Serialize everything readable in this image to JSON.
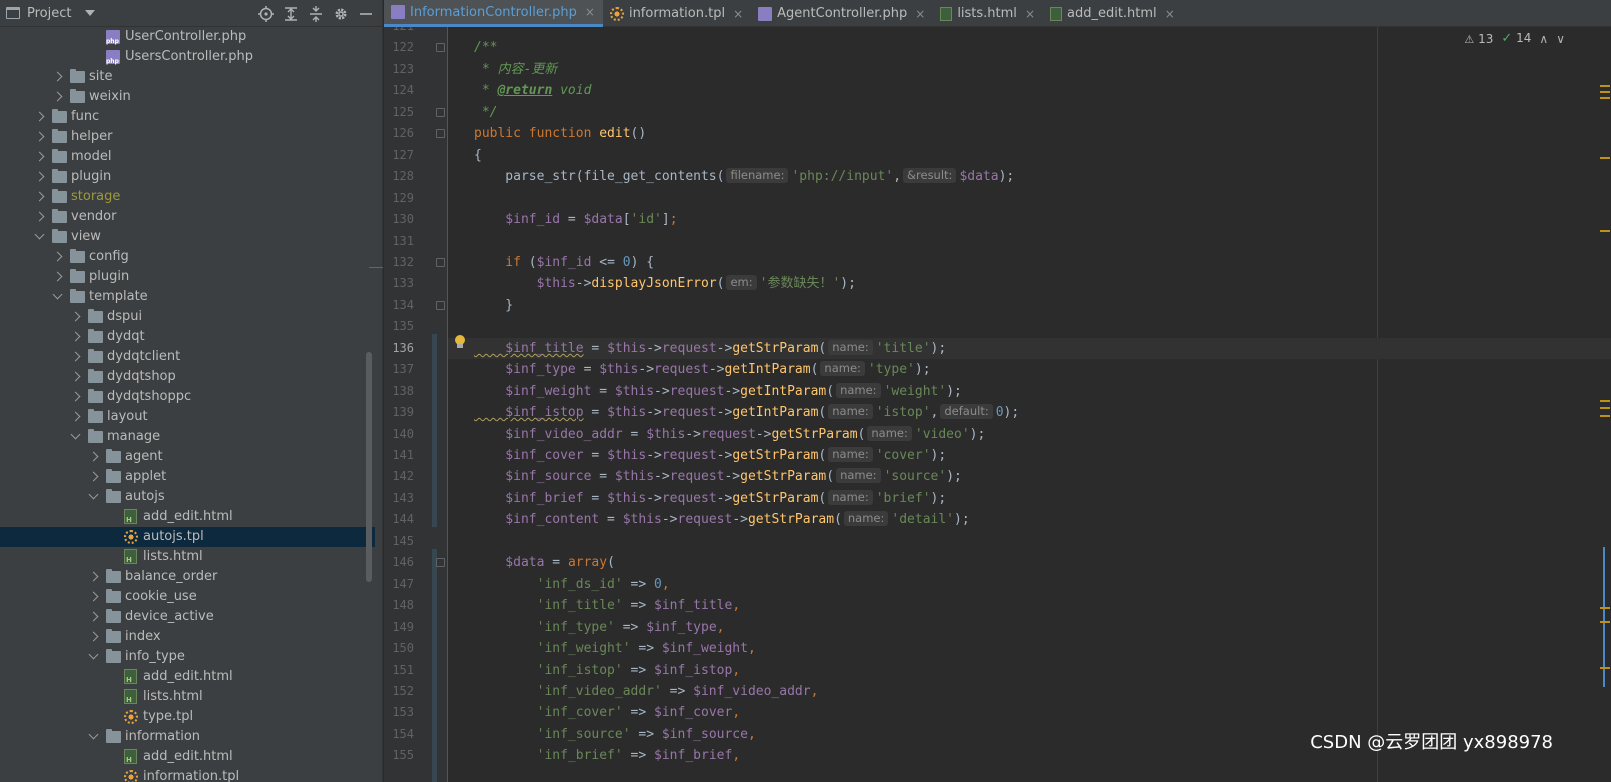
{
  "project_panel": {
    "title": "Project",
    "tree": [
      {
        "label": "UserController.php",
        "icon": "php",
        "depth": 6,
        "arrow": "none"
      },
      {
        "label": "UsersController.php",
        "icon": "php",
        "depth": 6,
        "arrow": "none"
      },
      {
        "label": "site",
        "icon": "folder",
        "depth": 4,
        "arrow": "closed"
      },
      {
        "label": "weixin",
        "icon": "folder",
        "depth": 4,
        "arrow": "closed"
      },
      {
        "label": "func",
        "icon": "folder",
        "depth": 3,
        "arrow": "closed"
      },
      {
        "label": "helper",
        "icon": "folder",
        "depth": 3,
        "arrow": "closed"
      },
      {
        "label": "model",
        "icon": "folder",
        "depth": 3,
        "arrow": "closed"
      },
      {
        "label": "plugin",
        "icon": "folder",
        "depth": 3,
        "arrow": "closed"
      },
      {
        "label": "storage",
        "icon": "folder",
        "depth": 3,
        "arrow": "closed",
        "dim": true
      },
      {
        "label": "vendor",
        "icon": "folder",
        "depth": 3,
        "arrow": "closed"
      },
      {
        "label": "view",
        "icon": "folder",
        "depth": 3,
        "arrow": "open"
      },
      {
        "label": "config",
        "icon": "folder",
        "depth": 4,
        "arrow": "closed"
      },
      {
        "label": "plugin",
        "icon": "folder",
        "depth": 4,
        "arrow": "closed"
      },
      {
        "label": "template",
        "icon": "folder",
        "depth": 4,
        "arrow": "open"
      },
      {
        "label": "dspui",
        "icon": "folder",
        "depth": 5,
        "arrow": "closed"
      },
      {
        "label": "dydqt",
        "icon": "folder",
        "depth": 5,
        "arrow": "closed"
      },
      {
        "label": "dydqtclient",
        "icon": "folder",
        "depth": 5,
        "arrow": "closed"
      },
      {
        "label": "dydqtshop",
        "icon": "folder",
        "depth": 5,
        "arrow": "closed"
      },
      {
        "label": "dydqtshoppc",
        "icon": "folder",
        "depth": 5,
        "arrow": "closed"
      },
      {
        "label": "layout",
        "icon": "folder",
        "depth": 5,
        "arrow": "closed"
      },
      {
        "label": "manage",
        "icon": "folder",
        "depth": 5,
        "arrow": "open"
      },
      {
        "label": "agent",
        "icon": "folder",
        "depth": 6,
        "arrow": "closed"
      },
      {
        "label": "applet",
        "icon": "folder",
        "depth": 6,
        "arrow": "closed"
      },
      {
        "label": "autojs",
        "icon": "folder",
        "depth": 6,
        "arrow": "open"
      },
      {
        "label": "add_edit.html",
        "icon": "html",
        "depth": 7,
        "arrow": "none"
      },
      {
        "label": "autojs.tpl",
        "icon": "tpl",
        "depth": 7,
        "arrow": "none",
        "selected": true
      },
      {
        "label": "lists.html",
        "icon": "html",
        "depth": 7,
        "arrow": "none"
      },
      {
        "label": "balance_order",
        "icon": "folder",
        "depth": 6,
        "arrow": "closed"
      },
      {
        "label": "cookie_use",
        "icon": "folder",
        "depth": 6,
        "arrow": "closed"
      },
      {
        "label": "device_active",
        "icon": "folder",
        "depth": 6,
        "arrow": "closed"
      },
      {
        "label": "index",
        "icon": "folder",
        "depth": 6,
        "arrow": "closed"
      },
      {
        "label": "info_type",
        "icon": "folder",
        "depth": 6,
        "arrow": "open"
      },
      {
        "label": "add_edit.html",
        "icon": "html",
        "depth": 7,
        "arrow": "none"
      },
      {
        "label": "lists.html",
        "icon": "html",
        "depth": 7,
        "arrow": "none"
      },
      {
        "label": "type.tpl",
        "icon": "tpl",
        "depth": 7,
        "arrow": "none"
      },
      {
        "label": "information",
        "icon": "folder",
        "depth": 6,
        "arrow": "open"
      },
      {
        "label": "add_edit.html",
        "icon": "html",
        "depth": 7,
        "arrow": "none"
      },
      {
        "label": "information.tpl",
        "icon": "tpl",
        "depth": 7,
        "arrow": "none"
      }
    ]
  },
  "tabs": [
    {
      "label": "InformationController.php",
      "icon": "php",
      "active": true
    },
    {
      "label": "information.tpl",
      "icon": "tpl",
      "active": false
    },
    {
      "label": "AgentController.php",
      "icon": "php",
      "active": false
    },
    {
      "label": "lists.html",
      "icon": "html",
      "active": false
    },
    {
      "label": "add_edit.html",
      "icon": "html",
      "active": false
    }
  ],
  "tab_close_glyph": "×",
  "inspections": {
    "warnings": "13",
    "ok": "14"
  },
  "current_line": 136,
  "editor_lines": [
    {
      "n": "121",
      "t": [
        [
          "p",
          ""
        ]
      ]
    },
    {
      "n": "122",
      "fold": true,
      "t": [
        [
          "c",
          "/**"
        ]
      ]
    },
    {
      "n": "123",
      "t": [
        [
          "c",
          " * 内容-更新"
        ]
      ]
    },
    {
      "n": "124",
      "t": [
        [
          "c",
          " * "
        ],
        [
          "ct",
          "@return"
        ],
        [
          "c",
          " void"
        ]
      ]
    },
    {
      "n": "125",
      "fold": true,
      "t": [
        [
          "c",
          " */"
        ]
      ]
    },
    {
      "n": "126",
      "fold": true,
      "t": [
        [
          "k",
          "public function "
        ],
        [
          "f",
          "edit"
        ],
        [
          "p",
          "()"
        ]
      ]
    },
    {
      "n": "127",
      "t": [
        [
          "p",
          "{"
        ]
      ]
    },
    {
      "n": "128",
      "t": [
        [
          "p",
          "    parse_str(file_get_contents("
        ],
        [
          "hint",
          "filename:"
        ],
        [
          "s",
          "'php://input'"
        ],
        [
          "p",
          ","
        ],
        [
          "hint",
          "&result:"
        ],
        [
          "v",
          "$data"
        ],
        [
          "p",
          ");"
        ]
      ]
    },
    {
      "n": "129",
      "t": [
        [
          "p",
          ""
        ]
      ]
    },
    {
      "n": "130",
      "t": [
        [
          "v",
          "    $inf_id"
        ],
        [
          "p",
          " = "
        ],
        [
          "v",
          "$data"
        ],
        [
          "p",
          "["
        ],
        [
          "s",
          "'id'"
        ],
        [
          "p",
          "]"
        ],
        [
          "k",
          ";"
        ]
      ]
    },
    {
      "n": "131",
      "t": [
        [
          "p",
          ""
        ]
      ]
    },
    {
      "n": "132",
      "fold": true,
      "t": [
        [
          "k",
          "    if "
        ],
        [
          "p",
          "("
        ],
        [
          "v",
          "$inf_id"
        ],
        [
          "p",
          " <= "
        ],
        [
          "n",
          "0"
        ],
        [
          "p",
          ") {"
        ]
      ]
    },
    {
      "n": "133",
      "t": [
        [
          "v",
          "        $this"
        ],
        [
          "p",
          "->"
        ],
        [
          "f",
          "displayJsonError"
        ],
        [
          "p",
          "("
        ],
        [
          "hint",
          "em:"
        ],
        [
          "s",
          "'参数缺失！'"
        ],
        [
          "p",
          ");"
        ]
      ]
    },
    {
      "n": "134",
      "fold": true,
      "t": [
        [
          "p",
          "    }"
        ]
      ]
    },
    {
      "n": "135",
      "t": [
        [
          "p",
          ""
        ]
      ]
    },
    {
      "n": "136",
      "t": [
        [
          "vu",
          "    $inf_title"
        ],
        [
          "p",
          " = "
        ],
        [
          "v",
          "$this"
        ],
        [
          "p",
          "->"
        ],
        [
          "v",
          "request"
        ],
        [
          "p",
          "->"
        ],
        [
          "f",
          "getStrParam"
        ],
        [
          "p",
          "("
        ],
        [
          "hint",
          "name:"
        ],
        [
          "s",
          "'title'"
        ],
        [
          "p",
          ");"
        ]
      ]
    },
    {
      "n": "137",
      "t": [
        [
          "v",
          "    $inf_type"
        ],
        [
          "p",
          " = "
        ],
        [
          "v",
          "$this"
        ],
        [
          "p",
          "->"
        ],
        [
          "v",
          "request"
        ],
        [
          "p",
          "->"
        ],
        [
          "f",
          "getIntParam"
        ],
        [
          "p",
          "("
        ],
        [
          "hint",
          "name:"
        ],
        [
          "s",
          "'type'"
        ],
        [
          "p",
          ");"
        ]
      ]
    },
    {
      "n": "138",
      "t": [
        [
          "v",
          "    $inf_weight"
        ],
        [
          "p",
          " = "
        ],
        [
          "v",
          "$this"
        ],
        [
          "p",
          "->"
        ],
        [
          "v",
          "request"
        ],
        [
          "p",
          "->"
        ],
        [
          "f",
          "getIntParam"
        ],
        [
          "p",
          "("
        ],
        [
          "hint",
          "name:"
        ],
        [
          "s",
          "'weight'"
        ],
        [
          "p",
          ");"
        ]
      ]
    },
    {
      "n": "139",
      "t": [
        [
          "vu",
          "    $inf_istop"
        ],
        [
          "p",
          " = "
        ],
        [
          "v",
          "$this"
        ],
        [
          "p",
          "->"
        ],
        [
          "v",
          "request"
        ],
        [
          "p",
          "->"
        ],
        [
          "f",
          "getIntParam"
        ],
        [
          "p",
          "("
        ],
        [
          "hint",
          "name:"
        ],
        [
          "s",
          "'istop'"
        ],
        [
          "p",
          ","
        ],
        [
          "hint",
          "default:"
        ],
        [
          "n",
          "0"
        ],
        [
          "p",
          ");"
        ]
      ]
    },
    {
      "n": "140",
      "t": [
        [
          "v",
          "    $inf_video_addr"
        ],
        [
          "p",
          " = "
        ],
        [
          "v",
          "$this"
        ],
        [
          "p",
          "->"
        ],
        [
          "v",
          "request"
        ],
        [
          "p",
          "->"
        ],
        [
          "f",
          "getStrParam"
        ],
        [
          "p",
          "("
        ],
        [
          "hint",
          "name:"
        ],
        [
          "s",
          "'video'"
        ],
        [
          "p",
          ");"
        ]
      ]
    },
    {
      "n": "141",
      "t": [
        [
          "v",
          "    $inf_cover"
        ],
        [
          "p",
          " = "
        ],
        [
          "v",
          "$this"
        ],
        [
          "p",
          "->"
        ],
        [
          "v",
          "request"
        ],
        [
          "p",
          "->"
        ],
        [
          "f",
          "getStrParam"
        ],
        [
          "p",
          "("
        ],
        [
          "hint",
          "name:"
        ],
        [
          "s",
          "'cover'"
        ],
        [
          "p",
          ");"
        ]
      ]
    },
    {
      "n": "142",
      "t": [
        [
          "v",
          "    $inf_source"
        ],
        [
          "p",
          " = "
        ],
        [
          "v",
          "$this"
        ],
        [
          "p",
          "->"
        ],
        [
          "v",
          "request"
        ],
        [
          "p",
          "->"
        ],
        [
          "f",
          "getStrParam"
        ],
        [
          "p",
          "("
        ],
        [
          "hint",
          "name:"
        ],
        [
          "s",
          "'source'"
        ],
        [
          "p",
          ");"
        ]
      ]
    },
    {
      "n": "143",
      "t": [
        [
          "v",
          "    $inf_brief"
        ],
        [
          "p",
          " = "
        ],
        [
          "v",
          "$this"
        ],
        [
          "p",
          "->"
        ],
        [
          "v",
          "request"
        ],
        [
          "p",
          "->"
        ],
        [
          "f",
          "getStrParam"
        ],
        [
          "p",
          "("
        ],
        [
          "hint",
          "name:"
        ],
        [
          "s",
          "'brief'"
        ],
        [
          "p",
          ");"
        ]
      ]
    },
    {
      "n": "144",
      "t": [
        [
          "v",
          "    $inf_content"
        ],
        [
          "p",
          " = "
        ],
        [
          "v",
          "$this"
        ],
        [
          "p",
          "->"
        ],
        [
          "v",
          "request"
        ],
        [
          "p",
          "->"
        ],
        [
          "f",
          "getStrParam"
        ],
        [
          "p",
          "("
        ],
        [
          "hint",
          "name:"
        ],
        [
          "s",
          "'detail'"
        ],
        [
          "p",
          ");"
        ]
      ]
    },
    {
      "n": "145",
      "t": [
        [
          "p",
          ""
        ]
      ]
    },
    {
      "n": "146",
      "fold": true,
      "t": [
        [
          "v",
          "    $data"
        ],
        [
          "p",
          " = "
        ],
        [
          "k",
          "array"
        ],
        [
          "p",
          "("
        ]
      ]
    },
    {
      "n": "147",
      "t": [
        [
          "s",
          "        'inf_ds_id'"
        ],
        [
          "p",
          " => "
        ],
        [
          "n",
          "0"
        ],
        [
          "k",
          ","
        ]
      ]
    },
    {
      "n": "148",
      "t": [
        [
          "s",
          "        'inf_title'"
        ],
        [
          "p",
          " => "
        ],
        [
          "v",
          "$inf_title"
        ],
        [
          "k",
          ","
        ]
      ]
    },
    {
      "n": "149",
      "t": [
        [
          "s",
          "        'inf_type'"
        ],
        [
          "p",
          " => "
        ],
        [
          "v",
          "$inf_type"
        ],
        [
          "k",
          ","
        ]
      ]
    },
    {
      "n": "150",
      "t": [
        [
          "s",
          "        'inf_weight'"
        ],
        [
          "p",
          " => "
        ],
        [
          "v",
          "$inf_weight"
        ],
        [
          "k",
          ","
        ]
      ]
    },
    {
      "n": "151",
      "t": [
        [
          "s",
          "        'inf_istop'"
        ],
        [
          "p",
          " => "
        ],
        [
          "v",
          "$inf_istop"
        ],
        [
          "k",
          ","
        ]
      ]
    },
    {
      "n": "152",
      "t": [
        [
          "s",
          "        'inf_video_addr'"
        ],
        [
          "p",
          " => "
        ],
        [
          "v",
          "$inf_video_addr"
        ],
        [
          "k",
          ","
        ]
      ]
    },
    {
      "n": "153",
      "t": [
        [
          "s",
          "        'inf_cover'"
        ],
        [
          "p",
          " => "
        ],
        [
          "v",
          "$inf_cover"
        ],
        [
          "k",
          ","
        ]
      ]
    },
    {
      "n": "154",
      "t": [
        [
          "s",
          "        'inf_source'"
        ],
        [
          "p",
          " => "
        ],
        [
          "v",
          "$inf_source"
        ],
        [
          "k",
          ","
        ]
      ]
    },
    {
      "n": "155",
      "t": [
        [
          "s",
          "        'inf_brief'"
        ],
        [
          "p",
          " => "
        ],
        [
          "v",
          "$inf_brief"
        ],
        [
          "k",
          ","
        ]
      ]
    }
  ],
  "watermark": "CSDN @云罗团团 yx898978",
  "colors": {
    "accent": "#4a88c7",
    "background": "#2b2b2b",
    "panel": "#3c3f41",
    "selection": "#0d293e"
  }
}
